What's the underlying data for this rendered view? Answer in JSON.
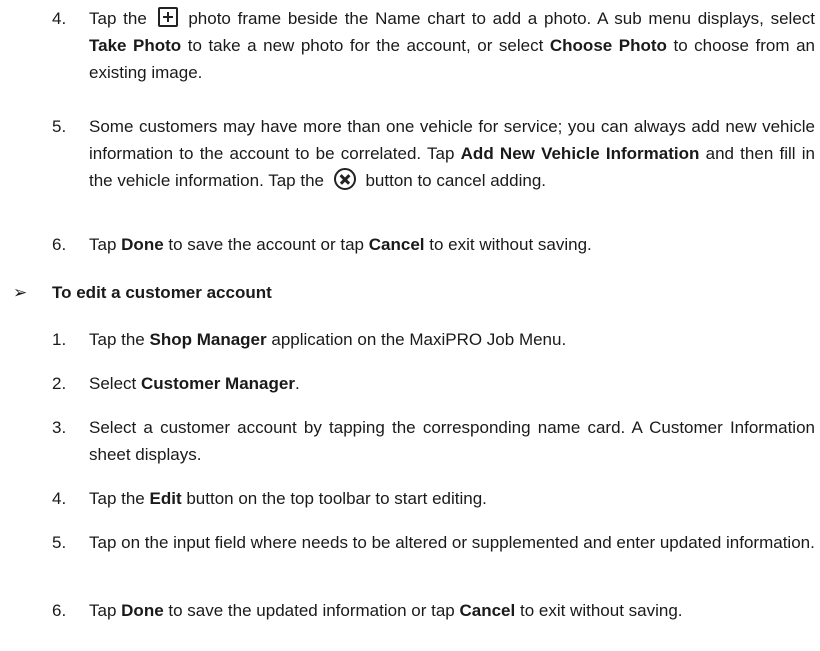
{
  "section_top": {
    "item4": {
      "number": "4.",
      "t1": "Tap the",
      "t2": "photo frame beside the Name chart to add a photo. A sub menu displays, select",
      "b1": "Take Photo",
      "t3": "to take a new photo for the account, or select",
      "b2": "Choose Photo",
      "t4": "to choose from an existing image.",
      "icon": "add-photo-icon"
    },
    "item5": {
      "number": "5.",
      "t1": "Some customers may have more than one vehicle for service; you can always add new vehicle information to the account to be correlated. Tap",
      "b1": "Add New Vehicle Information",
      "t2": "and then fill in the vehicle information. Tap the",
      "t3": "button to cancel adding.",
      "icon": "cancel-circle-icon"
    },
    "item6": {
      "number": "6.",
      "t1": "Tap",
      "b1": "Done",
      "t2": "to save the account or tap",
      "b2": "Cancel",
      "t3": "to exit without saving."
    }
  },
  "edit_section": {
    "arrow": "➢",
    "title": "To edit a customer account",
    "steps": [
      {
        "number": "1.",
        "t1": "Tap the",
        "b1": "Shop Manager",
        "t2": "application on the MaxiPRO Job Menu."
      },
      {
        "number": "2.",
        "t1": "Select",
        "b1": "Customer Manager",
        "t2": "."
      },
      {
        "number": "3.",
        "t1": "Select a customer account by tapping the corresponding name card. A Customer Information sheet displays."
      },
      {
        "number": "4.",
        "t1": "Tap the",
        "b1": "Edit",
        "t2": "button on the top toolbar to start editing."
      },
      {
        "number": "5.",
        "t1": "Tap on the input field where needs to be altered or supplemented and enter updated information."
      },
      {
        "number": "6.",
        "t1": "Tap",
        "b1": "Done",
        "t2": "to save the updated information or tap",
        "b2": "Cancel",
        "t3": "to exit without saving."
      }
    ]
  }
}
